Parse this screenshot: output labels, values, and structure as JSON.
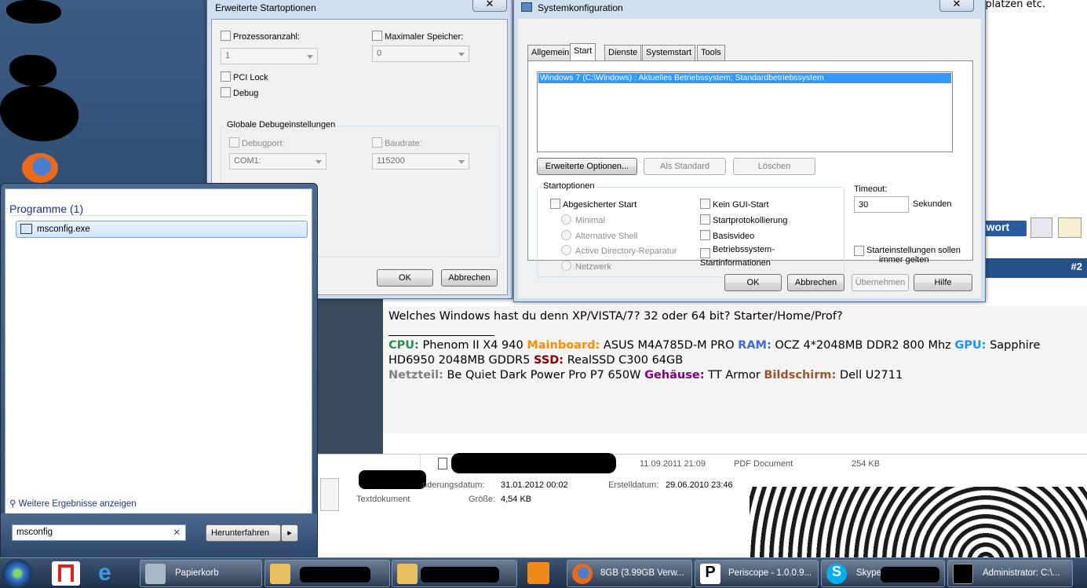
{
  "dialog_advanced": {
    "title": "Erweiterte Startoptionen",
    "processor_count_label": "Prozessoranzahl:",
    "processor_count_value": "1",
    "max_memory_label": "Maximaler Speicher:",
    "max_memory_value": "0",
    "pci_lock_label": "PCI Lock",
    "debug_label": "Debug",
    "global_debug_group": "Globale Debugeinstellungen",
    "debugport_label": "Debugport:",
    "debugport_value": "COM1:",
    "baudrate_label": "Baudrate:",
    "baudrate_value": "115200",
    "ok": "OK",
    "cancel": "Abbrechen",
    "close": "✕"
  },
  "dialog_sysconfig": {
    "title": "Systemkonfiguration",
    "tabs": [
      "Allgemein",
      "Start",
      "Dienste",
      "Systemstart",
      "Tools"
    ],
    "os_entry": "Windows 7 (C:\\Windows) : Aktuelles Betriebssystem; Standardbetriebssystem",
    "btn_advanced": "Erweiterte Optionen...",
    "btn_default": "Als Standard",
    "btn_delete": "Löschen",
    "boot_options_group": "Startoptionen",
    "safe_boot": "Abgesicherter Start",
    "minimal": "Minimal",
    "alt_shell": "Alternative Shell",
    "ad_repair": "Active Directory-Reparatur",
    "network": "Netzwerk",
    "no_gui": "Kein GUI-Start",
    "boot_log": "Startprotokollierung",
    "base_video": "Basisvideo",
    "os_boot_info_1": "Betriebssystem-",
    "os_boot_info_2": "Startinformationen",
    "timeout_label": "Timeout:",
    "timeout_value": "30",
    "seconds": "Sekunden",
    "permanent_1": "Starteinstellungen sollen",
    "permanent_2": "immer gelten",
    "ok": "OK",
    "cancel": "Abbrechen",
    "apply": "Übernehmen",
    "help": "Hilfe",
    "close": "✕"
  },
  "start_menu": {
    "section_title": "Programme (1)",
    "result": "msconfig.exe",
    "more_results": "Weitere Ergebnisse anzeigen",
    "search_value": "msconfig",
    "clear": "✕",
    "shutdown": "Herunterfahren",
    "shutdown_arrow": "▸"
  },
  "forum": {
    "post_number": "#2",
    "reply_label": "twort",
    "top_right_text": "kplatzen etc.",
    "question": "Welches Windows hast du denn XP/VISTA/7? 32 oder 64 bit? Starter/Home/Prof?",
    "sig": [
      {
        "label": "CPU:",
        "value": " Phenom II X4 940 ",
        "color": "#2e8b57"
      },
      {
        "label": "Mainboard:",
        "value": " ASUS M4A785D-M PRO ",
        "color": "#ff8c00"
      },
      {
        "label": "RAM:",
        "value": " OCZ 4*2048MB DDR2 800 Mhz ",
        "color": "#4169e1"
      },
      {
        "label": "GPU:",
        "value": " Sapphire HD6950 2048MB GDDR5 ",
        "color": "#1e90ff"
      },
      {
        "label": "SSD:",
        "value": " RealSSD C300 64GB",
        "color": "#8b0000"
      }
    ],
    "sig2": [
      {
        "label": "Netzteil:",
        "value": " Be Quiet Dark Power Pro P7 650W ",
        "color": "#808080"
      },
      {
        "label": "Gehäuse:",
        "value": " TT Armor ",
        "color": "#800080"
      },
      {
        "label": "Bildschirm:",
        "value": " Dell U2711",
        "color": "#a0522d"
      }
    ]
  },
  "explorer": {
    "file_date": "11.09.2011 21:09",
    "file_type": "PDF Document",
    "file_size": "254 KB",
    "changed_label": "nderungsdatum:",
    "changed_value": "31.01.2012 00:02",
    "created_label": "Erstelldatum:",
    "created_value": "29.06.2010 23:46",
    "doc_type": "Textdokument",
    "size_label": "Größe:",
    "size_value": "4,54 KB"
  },
  "taskbar": {
    "recycle": "Papierkorb",
    "firefox": "8GB (3.99GB Verw...",
    "periscope": "Periscope - 1.0.0.9...",
    "skype": "Skype",
    "cmd": "Administrator: C:\\..."
  }
}
